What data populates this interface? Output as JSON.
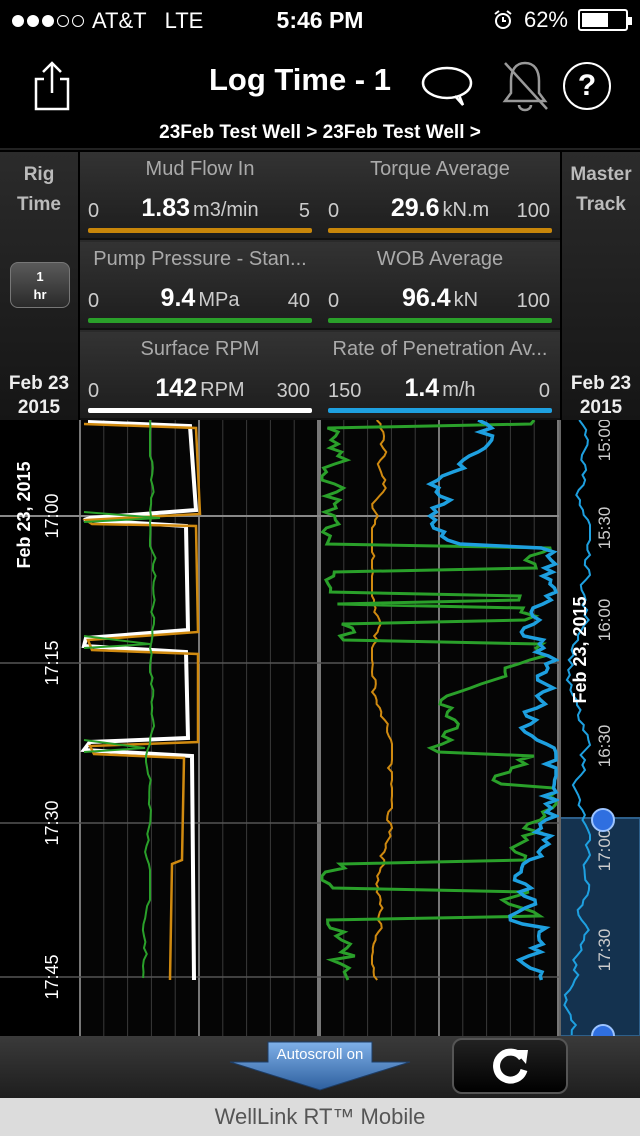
{
  "status_bar": {
    "carrier": "AT&T",
    "network": "LTE",
    "time": "5:46 PM",
    "battery": "62%",
    "signal_bars": 3,
    "battery_level": 0.62
  },
  "header": {
    "title": "Log Time - 1",
    "breadcrumb": "23Feb Test Well > 23Feb Test Well >",
    "share_icon": "share-icon",
    "comment_icon": "comment-icon",
    "alarm_icon": "bell-muted-icon",
    "help_label": "?"
  },
  "left_panel": {
    "label_line1": "Rig",
    "label_line2": "Time",
    "interval_value": "1",
    "interval_unit": "hr",
    "date_line1": "Feb 23",
    "date_line2": "2015"
  },
  "right_panel": {
    "label_line1": "Master",
    "label_line2": "Track",
    "date_line1": "Feb 23",
    "date_line2": "2015"
  },
  "gauges": [
    {
      "name": "Mud Flow In",
      "value": "1.83",
      "unit": "m3/min",
      "min": "0",
      "max": "5",
      "color": "#c8860a"
    },
    {
      "name": "Torque Average",
      "value": "29.6",
      "unit": "kN.m",
      "min": "0",
      "max": "100",
      "color": "#c8860a"
    },
    {
      "name": "Pump Pressure - Stan...",
      "value": "9.4",
      "unit": "MPa",
      "min": "0",
      "max": "40",
      "color": "#2aa02a"
    },
    {
      "name": "WOB Average",
      "value": "96.4",
      "unit": "kN",
      "min": "0",
      "max": "100",
      "color": "#2aa02a"
    },
    {
      "name": "Surface RPM",
      "value": "142",
      "unit": "RPM",
      "min": "0",
      "max": "300",
      "color": "#ffffff"
    },
    {
      "name": "Rate of Penetration Av...",
      "value": "1.4",
      "unit": "m/h",
      "min": "150",
      "max": "0",
      "color": "#1ea0e0"
    }
  ],
  "time_axis": {
    "date_label": "Feb 23, 2015",
    "ticks": [
      "17:00",
      "17:15",
      "17:30",
      "17:45"
    ]
  },
  "master_axis": {
    "date_label": "Feb 23, 2015",
    "ticks": [
      "15:00",
      "15:30",
      "16:00",
      "16:30",
      "17:00",
      "17:30"
    ]
  },
  "footer": {
    "autoscroll_label": "Autoscroll on",
    "refresh_icon": "refresh-icon",
    "brand": "WellLink RT™ Mobile"
  }
}
